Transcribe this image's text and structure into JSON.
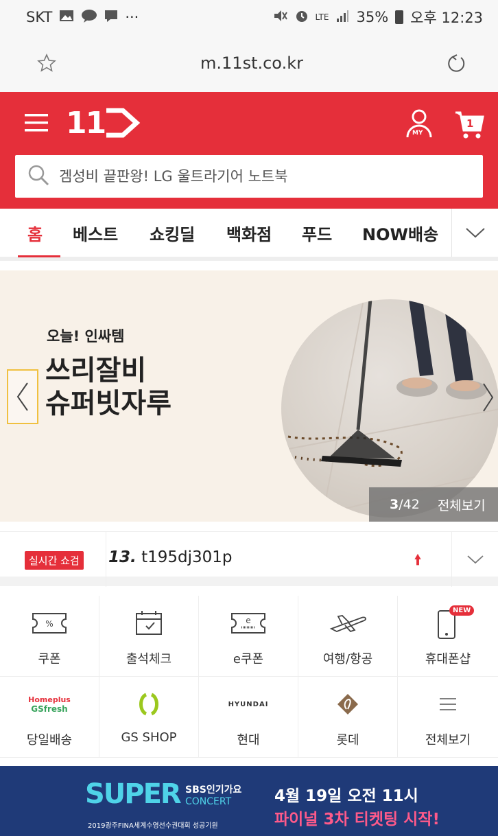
{
  "status_bar": {
    "carrier": "SKT",
    "network": "LTE",
    "battery": "35%",
    "time": "오후 12:23",
    "icons": [
      "gallery-icon",
      "talk-icon",
      "message-icon",
      "more-icon",
      "mute-icon",
      "alarm-icon",
      "signal-icon",
      "battery-icon"
    ]
  },
  "browser": {
    "url": "m.11st.co.kr",
    "icons": [
      "star-icon",
      "reload-icon"
    ]
  },
  "header": {
    "logo": "11",
    "my_label": "MY",
    "cart_count": "1",
    "search_placeholder": "겜성비 끝판왕! LG 울트라기어 노트북",
    "accent": "#e52f3a"
  },
  "nav": {
    "tabs": [
      {
        "label": "홈",
        "active": true
      },
      {
        "label": "베스트",
        "active": false
      },
      {
        "label": "쇼킹딜",
        "active": false
      },
      {
        "label": "백화점",
        "active": false
      },
      {
        "label": "푸드",
        "active": false
      },
      {
        "label": "NOW배송",
        "active": false
      }
    ]
  },
  "banner": {
    "subtitle": "오늘! 인싸템",
    "title_line1": "쓰리잘비",
    "title_line2": "슈퍼빗자루",
    "counter_current": "3",
    "counter_total": "/42",
    "view_all": "전체보기"
  },
  "realtime": {
    "badge": "실시간 쇼검",
    "rank": "13.",
    "keyword": "t195dj301p",
    "trend": "up"
  },
  "shortcuts": [
    {
      "label": "쿠폰",
      "icon": "coupon-icon"
    },
    {
      "label": "출석체크",
      "icon": "calendar-check-icon"
    },
    {
      "label": "e쿠폰",
      "icon": "e-coupon-icon"
    },
    {
      "label": "여행/항공",
      "icon": "airplane-icon"
    },
    {
      "label": "휴대폰샵",
      "icon": "phone-icon",
      "badge": "NEW"
    },
    {
      "label": "당일배송",
      "icon": "homeplus-gsfresh-logo",
      "logo_line1": "Homeplus",
      "logo_line2": "GSfresh"
    },
    {
      "label": "GS SHOP",
      "icon": "gsshop-logo"
    },
    {
      "label": "현대",
      "icon": "hyundai-logo",
      "logo_text": "HYUNDAI"
    },
    {
      "label": "롯데",
      "icon": "lotte-logo"
    },
    {
      "label": "전체보기",
      "icon": "menu-icon"
    }
  ],
  "promo": {
    "logo_text": "SUPER",
    "logo_badge": "SBS인기가요",
    "logo_sub": "CONCERT",
    "caption": "2019광주FINA세계수영선수권대회 성공기원",
    "line1": "4월 19일 오전 11시",
    "line2": "파이널 3차 티켓팅 시작!"
  }
}
